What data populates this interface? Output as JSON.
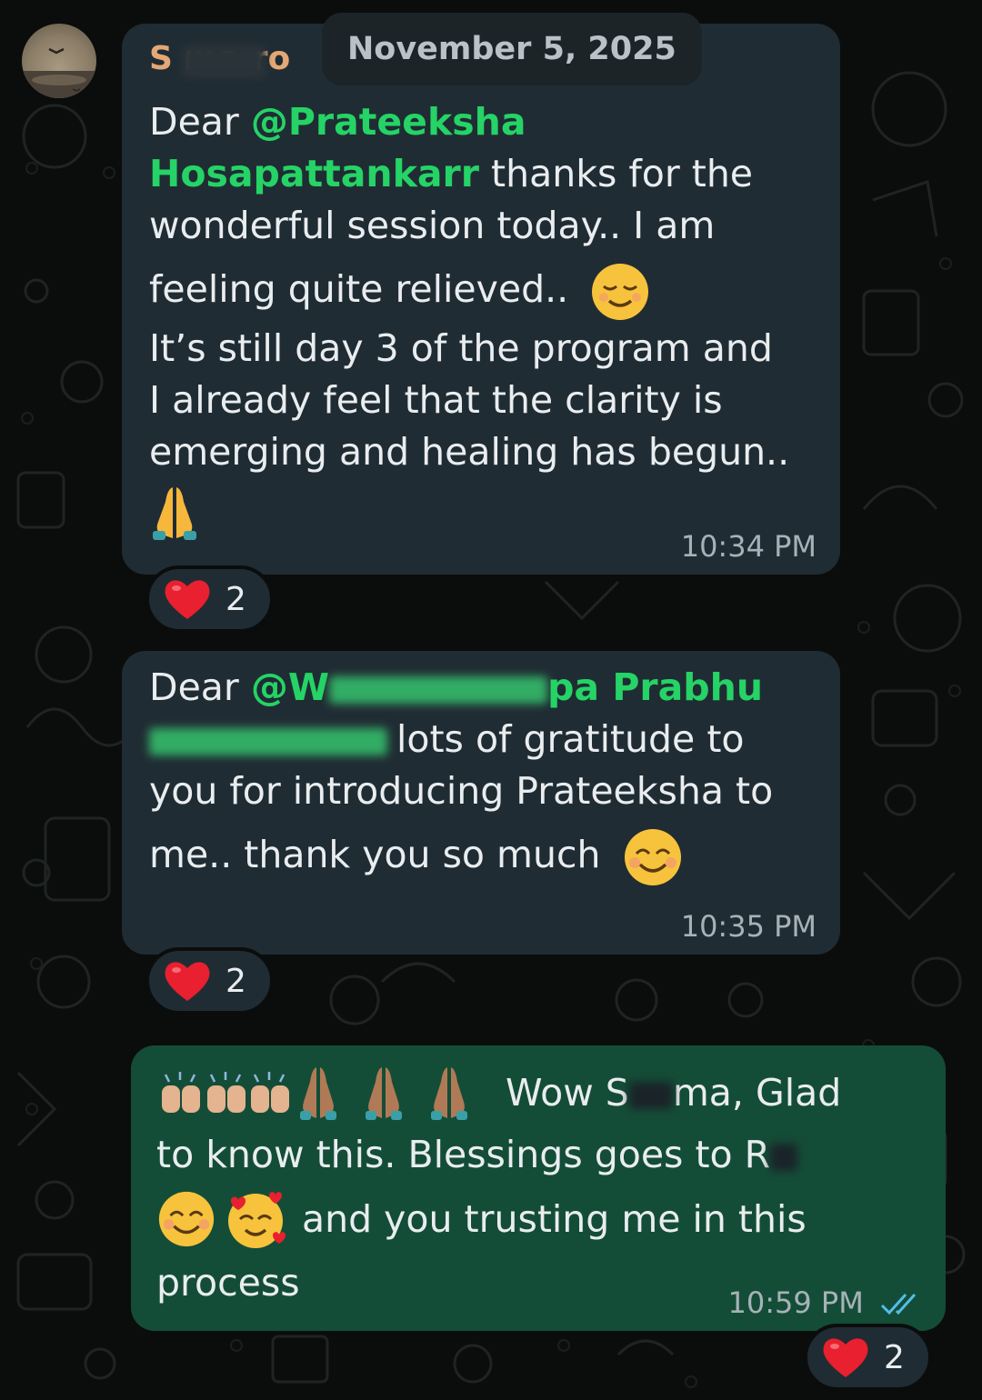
{
  "date_chip": "November 5, 2025",
  "messages": [
    {
      "sender": "S     ma ro",
      "mention": "@Prateeksha Hosapattankarr",
      "text_greeting": "Dear",
      "text_line1": " thanks for the",
      "text_line2": "wonderful session today.. I am",
      "text_line3": "feeling quite relieved..",
      "text_line4": "It’s still day 3 of the program and",
      "text_line5": "I already feel that the clarity is",
      "text_line6": "emerging and healing has begun..",
      "time": "10:34 PM",
      "reaction": {
        "emoji": "heart",
        "count": "2"
      }
    },
    {
      "text_greeting": "Dear",
      "mention_start": "@W",
      "mention_end": "pa Prabhu",
      "text_line1": "lots of gratitude to",
      "text_line2": "you for introducing Prateeksha to",
      "text_line3": "me.. thank you so much",
      "time": "10:35 PM",
      "reaction": {
        "emoji": "heart",
        "count": "2"
      }
    },
    {
      "text_line1_a": "Wow S",
      "text_line1_b": "ma, Glad",
      "text_line2": "to know this. Blessings goes to R",
      "text_line3": "and you trusting me in this",
      "text_line4": "process",
      "time": "10:59 PM",
      "status": "read",
      "reaction": {
        "emoji": "heart",
        "count": "2"
      }
    }
  ],
  "colors": {
    "incoming_bubble": "#202c33",
    "outgoing_bubble": "#144d37",
    "mention": "#25d366",
    "sender_name": "#e3a875",
    "read_ticks": "#53bdeb"
  }
}
